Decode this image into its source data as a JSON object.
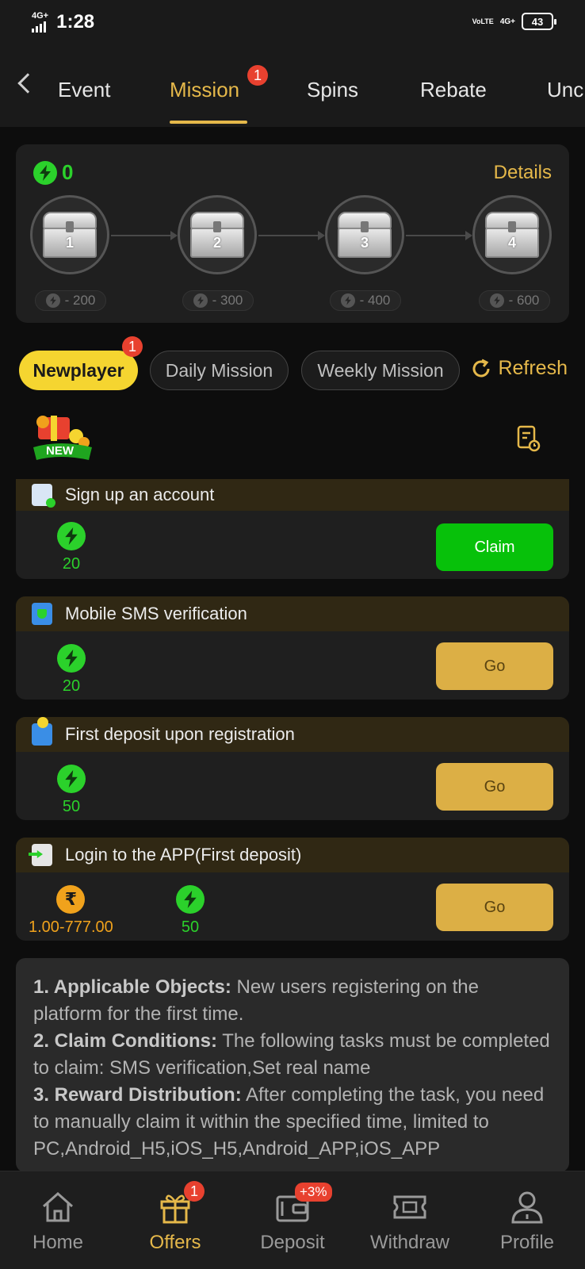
{
  "status": {
    "network": "4G+",
    "time": "1:28",
    "right_net": "4G+",
    "volte": "VoLTE",
    "battery": "43"
  },
  "nav": {
    "tabs": [
      {
        "label": "Event"
      },
      {
        "label": "Mission",
        "badge": "1"
      },
      {
        "label": "Spins"
      },
      {
        "label": "Rebate"
      },
      {
        "label": "Unc"
      }
    ],
    "active_tab": "Mission"
  },
  "progress": {
    "energy": "0",
    "details_label": "Details",
    "chests": [
      {
        "number": "1",
        "cost": "- 200"
      },
      {
        "number": "2",
        "cost": "- 300"
      },
      {
        "number": "3",
        "cost": "- 400"
      },
      {
        "number": "4",
        "cost": "- 600"
      }
    ]
  },
  "mission_tabs": {
    "items": [
      {
        "label": "Newplayer",
        "badge": "1"
      },
      {
        "label": "Daily Mission"
      },
      {
        "label": "Weekly Mission"
      }
    ],
    "refresh_label": "Refresh"
  },
  "new_badge": "NEW",
  "tasks": [
    {
      "title": "Sign up an account",
      "reward": "20",
      "button": "Claim",
      "state": "claim"
    },
    {
      "title": "Mobile SMS verification",
      "reward": "20",
      "button": "Go",
      "state": "go"
    },
    {
      "title": "First deposit upon registration",
      "reward": "50",
      "button": "Go",
      "state": "go"
    },
    {
      "title": "Login to the APP(First deposit)",
      "cash_range": "1.00-777.00",
      "reward": "50",
      "button": "Go",
      "state": "go"
    }
  ],
  "rules": [
    {
      "heading": "1. Applicable Objects:",
      "text": " New users registering on the platform for the first time."
    },
    {
      "heading": "2. Claim Conditions:",
      "text": " The following tasks must be completed to claim: SMS verification,Set real name"
    },
    {
      "heading": "3. Reward Distribution:",
      "text": " After completing the task, you need to manually claim it within the specified time, limited to PC,Android_H5,iOS_H5,Android_APP,iOS_APP"
    }
  ],
  "bottom_nav": {
    "items": [
      {
        "label": "Home"
      },
      {
        "label": "Offers",
        "badge": "1"
      },
      {
        "label": "Deposit",
        "badge": "+3%"
      },
      {
        "label": "Withdraw"
      },
      {
        "label": "Profile"
      }
    ],
    "active": "Offers"
  },
  "colors": {
    "accent_gold": "#e5b84a",
    "energy_green": "#2bd12b",
    "claim_green": "#07c10a",
    "badge_red": "#e8412f",
    "pill_yellow": "#f5d530"
  }
}
